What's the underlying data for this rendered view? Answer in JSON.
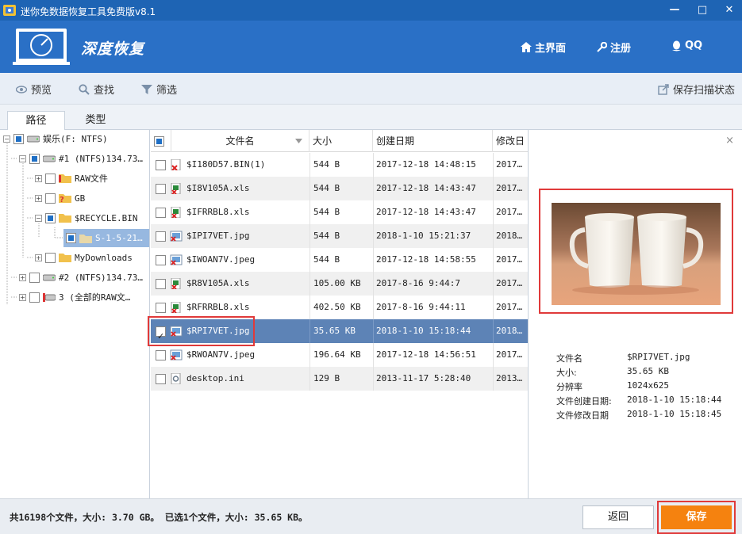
{
  "window": {
    "title": "迷你免数据恢复工具免费版v8.1",
    "minimize": "—",
    "maximize": "□",
    "close": "✕"
  },
  "header": {
    "brand": "深度恢复",
    "home_label": "主界面",
    "register_label": "注册",
    "qq_label": "QQ"
  },
  "toolbar": {
    "preview_label": "预览",
    "find_label": "查找",
    "filter_label": "筛选",
    "save_scan_label": "保存扫描状态"
  },
  "tabs": [
    {
      "label": "路径"
    },
    {
      "label": "类型"
    }
  ],
  "tree": [
    {
      "label": "娱乐(F: NTFS)",
      "check": "partial"
    },
    {
      "label": "#1 (NTFS)134.73…",
      "check": "partial"
    },
    {
      "label": "RAW文件",
      "check": "none"
    },
    {
      "label": "GB",
      "check": "none"
    },
    {
      "label": "$RECYCLE.BIN",
      "check": "partial"
    },
    {
      "label": "S-1-5-21…",
      "check": "partial"
    },
    {
      "label": "MyDownloads",
      "check": "none"
    },
    {
      "label": "#2 (NTFS)134.73…",
      "check": "none"
    },
    {
      "label": "3 (全部的RAW文…",
      "check": "none"
    }
  ],
  "filelist": {
    "columns": {
      "name": "文件名",
      "size": "大小",
      "created": "创建日期",
      "modified": "修改日"
    },
    "rows": [
      {
        "name": "$I180D57.BIN(1)",
        "size": "544 B",
        "created": "2017-12-18 14:48:15",
        "modified": "2017…",
        "icon": "bin-file-icon",
        "checked": false
      },
      {
        "name": "$I8V105A.xls",
        "size": "544 B",
        "created": "2017-12-18 14:43:47",
        "modified": "2017…",
        "icon": "xls-file-icon",
        "checked": false
      },
      {
        "name": "$IFRRBL8.xls",
        "size": "544 B",
        "created": "2017-12-18 14:43:47",
        "modified": "2017…",
        "icon": "xls-file-icon",
        "checked": false
      },
      {
        "name": "$IPI7VET.jpg",
        "size": "544 B",
        "created": "2018-1-10 15:21:37",
        "modified": "2018…",
        "icon": "image-file-icon",
        "checked": false
      },
      {
        "name": "$IWOAN7V.jpeg",
        "size": "544 B",
        "created": "2017-12-18 14:58:55",
        "modified": "2017…",
        "icon": "image-file-icon",
        "checked": false
      },
      {
        "name": "$R8V105A.xls",
        "size": "105.00 KB",
        "created": "2017-8-16 9:44:7",
        "modified": "2017…",
        "icon": "xls-file-icon",
        "checked": false
      },
      {
        "name": "$RFRRBL8.xls",
        "size": "402.50 KB",
        "created": "2017-8-16 9:44:11",
        "modified": "2017…",
        "icon": "xls-file-icon",
        "checked": false
      },
      {
        "name": "$RPI7VET.jpg",
        "size": "35.65 KB",
        "created": "2018-1-10 15:18:44",
        "modified": "2018…",
        "icon": "image-file-icon",
        "checked": true
      },
      {
        "name": "$RWOAN7V.jpeg",
        "size": "196.64 KB",
        "created": "2017-12-18 14:56:51",
        "modified": "2017…",
        "icon": "image-file-icon",
        "checked": false
      },
      {
        "name": "desktop.ini",
        "size": "129 B",
        "created": "2013-11-17 5:28:40",
        "modified": "2013…",
        "icon": "ini-file-icon",
        "checked": false
      }
    ]
  },
  "preview": {
    "close": "×",
    "info": [
      {
        "key": "文件名",
        "value": "$RPI7VET.jpg"
      },
      {
        "key": "大小:",
        "value": "35.65 KB"
      },
      {
        "key": "分辨率",
        "value": "1024x625"
      },
      {
        "key": "文件创建日期:",
        "value": "2018-1-10 15:18:44"
      },
      {
        "key": "文件修改日期",
        "value": "2018-1-10 15:18:45"
      }
    ]
  },
  "status": {
    "text": "共16198个文件，大小: 3.70 GB。 已选1个文件，大小: 35.65 KB。",
    "back_label": "返回",
    "save_label": "保存"
  },
  "colors": {
    "titlebar": "#1e64b4",
    "header": "#2a70c6",
    "selected_row": "#5d83b6",
    "save": "#f5820f",
    "highlight": "#e03a3a"
  }
}
